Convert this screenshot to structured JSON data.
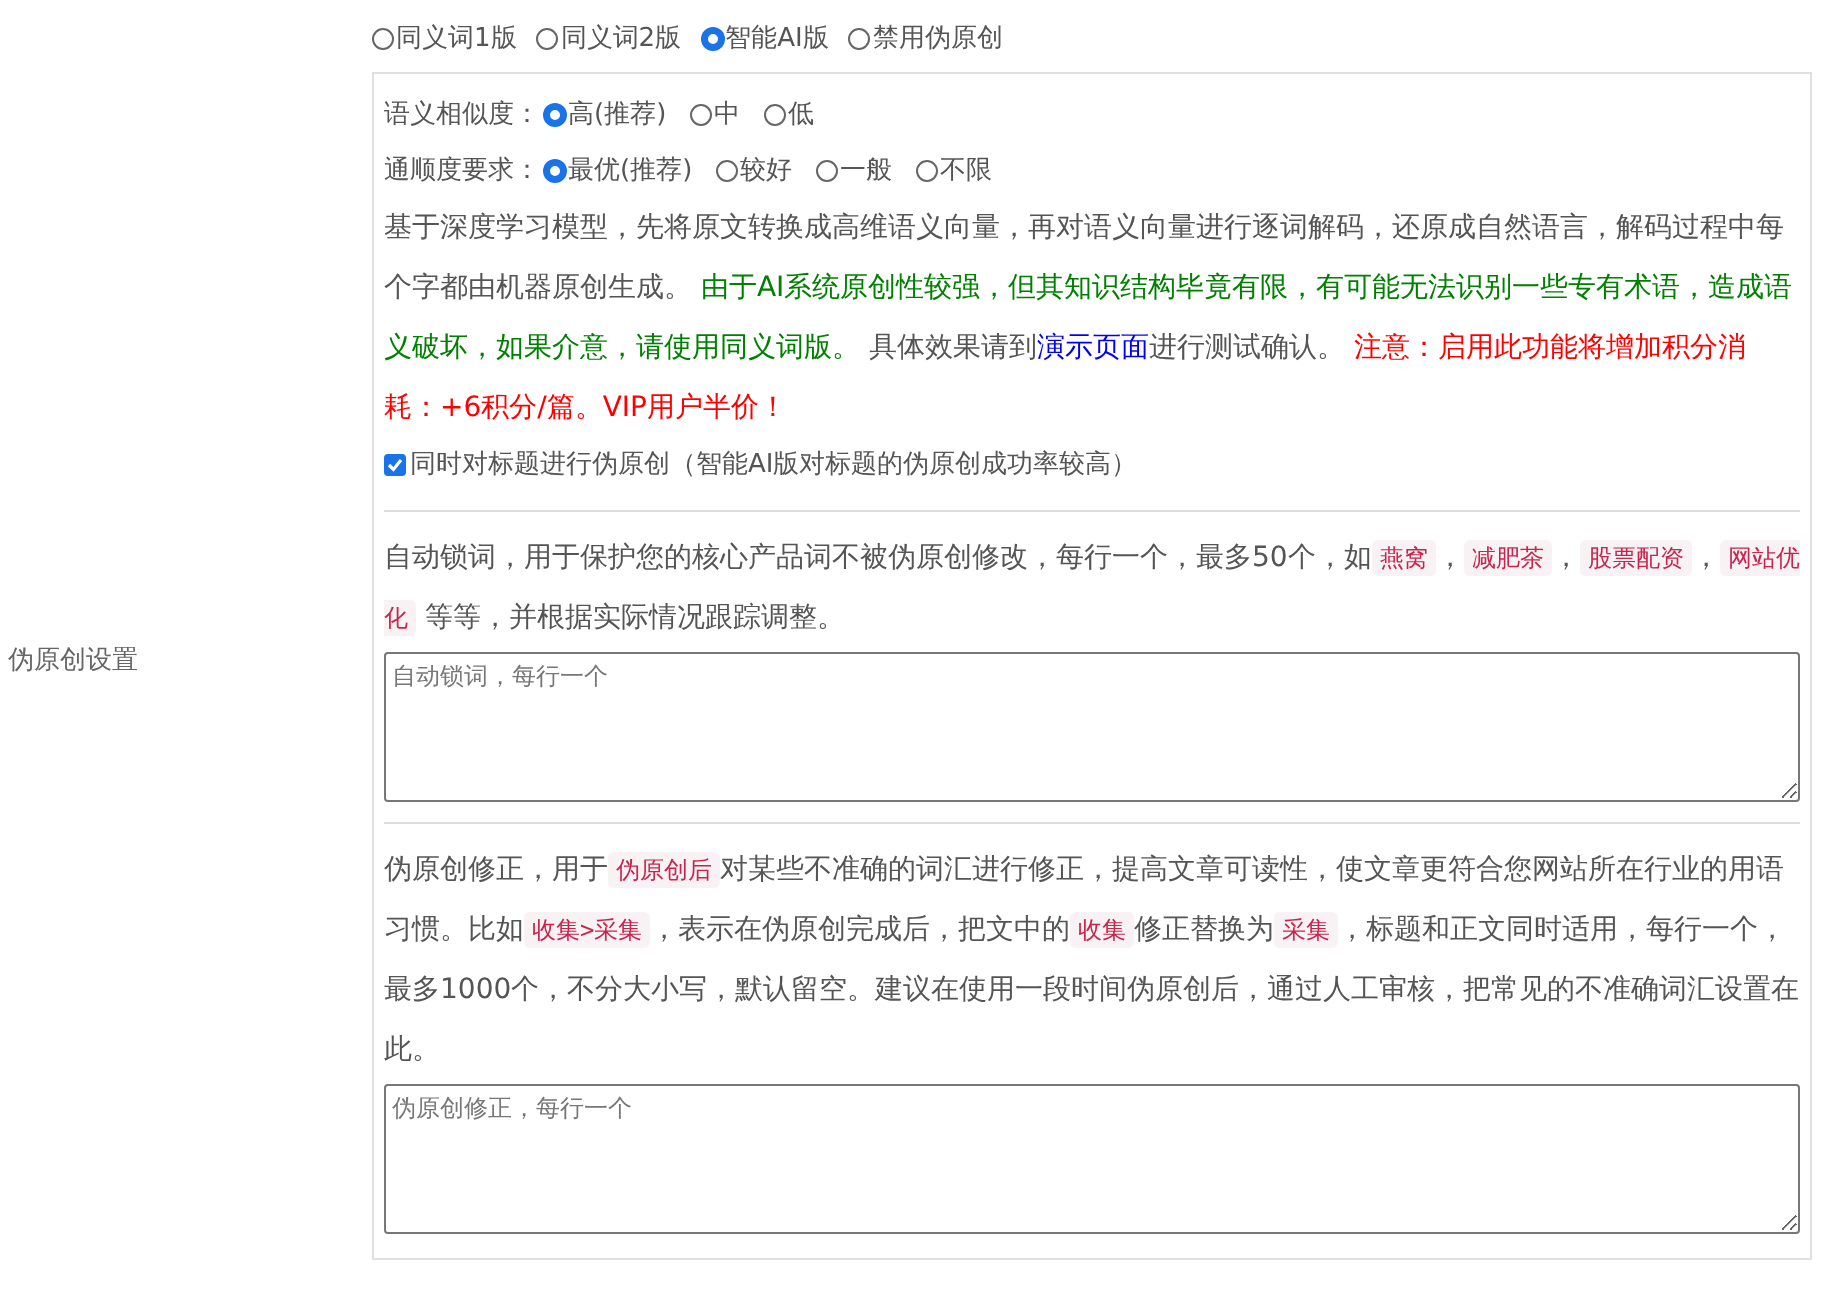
{
  "row_label": "伪原创设置",
  "modes": [
    {
      "label": "同义词1版",
      "selected": false
    },
    {
      "label": "同义词2版",
      "selected": false
    },
    {
      "label": "智能AI版",
      "selected": true
    },
    {
      "label": "禁用伪原创",
      "selected": false
    }
  ],
  "ai_settings": {
    "groups": [
      {
        "label": "语义相似度：",
        "options": [
          {
            "label": "高(推荐)",
            "selected": true
          },
          {
            "label": "中",
            "selected": false
          },
          {
            "label": "低",
            "selected": false
          }
        ]
      },
      {
        "label": "通顺度要求：",
        "options": [
          {
            "label": "最优(推荐)",
            "selected": true
          },
          {
            "label": "较好",
            "selected": false
          },
          {
            "label": "一般",
            "selected": false
          },
          {
            "label": "不限",
            "selected": false
          }
        ]
      }
    ],
    "description": [
      {
        "kind": "plain",
        "text": "基于深度学习模型，先将原文转换成高维语义向量，再对语义向量进行逐词解码，还原成自然语言，解码过程中每个字都由机器原创生成。 "
      },
      {
        "kind": "green",
        "text": "由于AI系统原创性较强，但其知识结构毕竟有限，有可能无法识别一些专有术语，造成语义破坏，如果介意，请使用同义词版。"
      },
      {
        "kind": "plain",
        "text": " 具体效果请到"
      },
      {
        "kind": "link",
        "text": "演示页面"
      },
      {
        "kind": "plain",
        "text": "进行测试确认。 "
      },
      {
        "kind": "red",
        "text": "注意：启用此功能将增加积分消耗：+6积分/篇。VIP用户半价！"
      }
    ],
    "title_option": {
      "label": "同时对标题进行伪原创（智能AI版对标题的伪原创成功率较高）",
      "checked": true
    }
  },
  "lock_words": {
    "description": [
      {
        "kind": "plain",
        "text": "自动锁词，用于保护您的核心产品词不被伪原创修改，每行一个，最多50个，如"
      },
      {
        "kind": "code",
        "text": "燕窝"
      },
      {
        "kind": "plain",
        "text": "，"
      },
      {
        "kind": "code",
        "text": "减肥茶"
      },
      {
        "kind": "plain",
        "text": "，"
      },
      {
        "kind": "code",
        "text": "股票配资"
      },
      {
        "kind": "plain",
        "text": "，"
      },
      {
        "kind": "code",
        "text": "网站优化"
      },
      {
        "kind": "plain",
        "text": " 等等，并根据实际情况跟踪调整。"
      }
    ],
    "placeholder": "自动锁词，每行一个"
  },
  "corrections": {
    "description": [
      {
        "kind": "plain",
        "text": "伪原创修正，用于"
      },
      {
        "kind": "code",
        "text": "伪原创后"
      },
      {
        "kind": "plain",
        "text": "对某些不准确的词汇进行修正，提高文章可读性，使文章更符合您网站所在行业的用语习惯。比如"
      },
      {
        "kind": "code",
        "text": "收集>采集"
      },
      {
        "kind": "plain",
        "text": "，表示在伪原创完成后，把文中的"
      },
      {
        "kind": "code",
        "text": "收集"
      },
      {
        "kind": "plain",
        "text": "修正替换为"
      },
      {
        "kind": "code",
        "text": "采集"
      },
      {
        "kind": "plain",
        "text": "，标题和正文同时适用，每行一个，最多1000个，不分大小写，默认留空。建议在使用一段时间伪原创后，通过人工审核，把常见的不准确词汇设置在此。"
      }
    ],
    "placeholder": "伪原创修正，每行一个"
  }
}
